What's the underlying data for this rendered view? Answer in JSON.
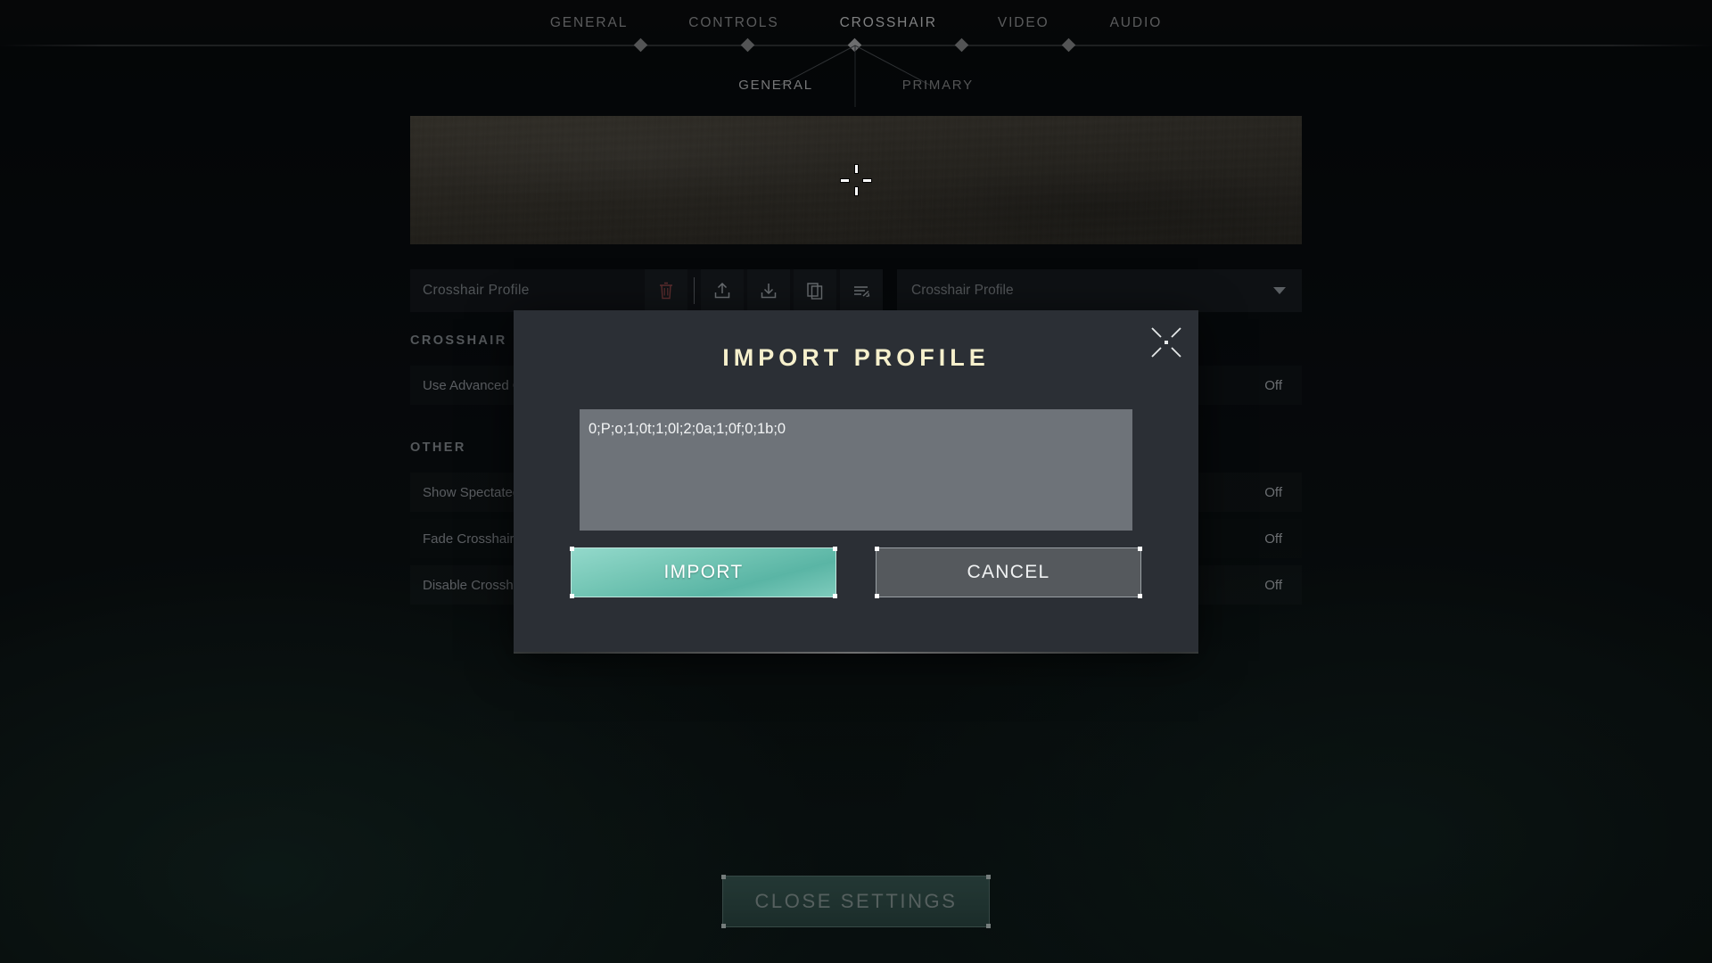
{
  "app": {
    "main_tabs": [
      {
        "label": "GENERAL",
        "active": false
      },
      {
        "label": "CONTROLS",
        "active": false
      },
      {
        "label": "CROSSHAIR",
        "active": true
      },
      {
        "label": "VIDEO",
        "active": false
      },
      {
        "label": "AUDIO",
        "active": false
      }
    ],
    "sub_tabs": [
      {
        "label": "GENERAL",
        "active": true
      },
      {
        "label": "PRIMARY",
        "active": false
      }
    ]
  },
  "profile_bar": {
    "name_label": "Crosshair Profile",
    "dropdown_value": "Crosshair Profile",
    "icons": [
      {
        "name": "delete-icon",
        "title": "Delete"
      },
      {
        "name": "upload-icon",
        "title": "Export"
      },
      {
        "name": "download-icon",
        "title": "Import"
      },
      {
        "name": "copy-icon",
        "title": "Duplicate"
      },
      {
        "name": "rename-icon",
        "title": "Rename"
      }
    ]
  },
  "sections": [
    {
      "heading": "CROSSHAIR",
      "rows": [
        {
          "label": "Use Advanced Options",
          "value": "Off"
        }
      ]
    },
    {
      "heading": "OTHER",
      "rows": [
        {
          "label": "Show Spectated Player's Crosshair",
          "value": "Off"
        },
        {
          "label": "Fade Crosshair With Firing Error",
          "value": "Off"
        },
        {
          "label": "Disable Crosshair While Zooming",
          "value": "Off"
        }
      ]
    }
  ],
  "footer": {
    "close_settings_label": "CLOSE SETTINGS"
  },
  "modal": {
    "title": "IMPORT PROFILE",
    "input_value": "0;P;o;1;0t;1;0l;2;0a;1;0f;0;1b;0",
    "input_placeholder": "",
    "import_label": "IMPORT",
    "cancel_label": "CANCEL",
    "close_icon": "crosshair-close-icon"
  },
  "colors": {
    "accent_teal": "#74c6b5",
    "title_cream": "#f6f0cc",
    "danger_red": "#9e4a4a",
    "panel": "#2b2f35",
    "input_bg": "#6e7379"
  }
}
